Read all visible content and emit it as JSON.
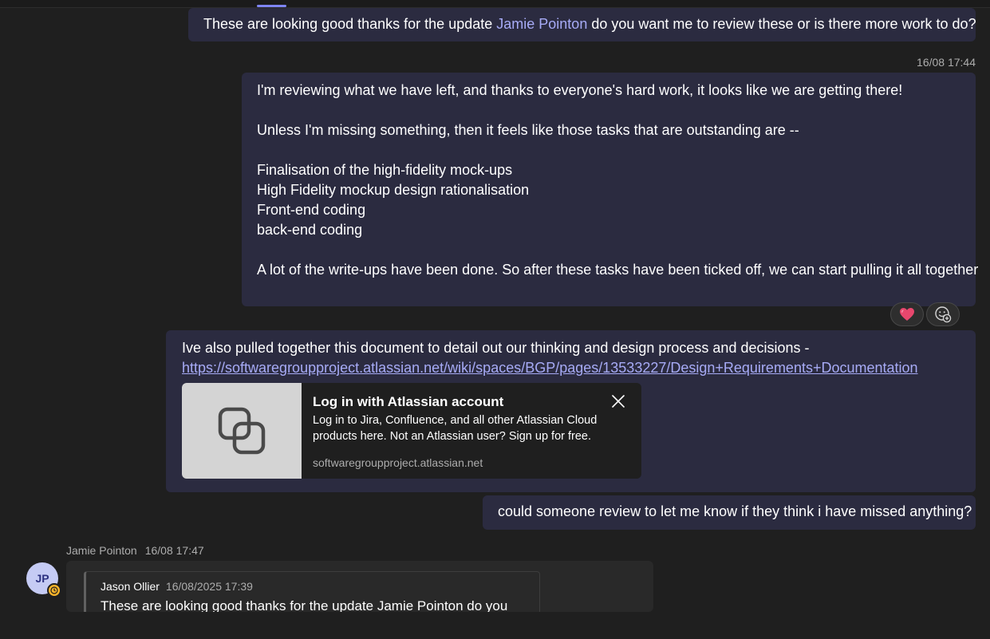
{
  "messages": {
    "m1": {
      "prefix": "These are looking good thanks for the update ",
      "mention": "Jamie Pointon",
      "suffix": " do you want me to review these or is there more work to do?"
    },
    "m2": {
      "timestamp": "16/08 17:44",
      "lines": [
        "I'm reviewing what we have left, and thanks to everyone's hard work, it looks like we are getting there!",
        "",
        "Unless I'm missing something, then it feels like those tasks that are outstanding are --",
        "",
        "Finalisation of the high-fidelity mock-ups",
        "High Fidelity mockup design rationalisation",
        "Front-end coding",
        "back-end coding",
        "",
        "A lot of the write-ups have been done. So after these tasks have been ticked off, we can start pulling it all together"
      ],
      "reactions": [
        "heart-emoji",
        "add-reaction-icon"
      ]
    },
    "m3": {
      "text": "Ive also pulled together this document to detail out our thinking and design process and decisions -",
      "link": "https://softwaregroupproject.atlassian.net/wiki/spaces/BGP/pages/13533227/Design+Requirements+Documentation",
      "preview": {
        "title": "Log in with Atlassian account",
        "description": "Log in to Jira, Confluence, and all other Atlassian Cloud products here. Not an Atlassian user? Sign up for free.",
        "domain": "softwaregroupproject.atlassian.net"
      }
    },
    "m4": {
      "text": "could someone review to let me know if they think i have missed anything?"
    },
    "m5": {
      "author": "Jamie Pointon",
      "timestamp": "16/08 17:47",
      "avatar_initials": "JP",
      "presence": "away",
      "quote": {
        "author": "Jason Ollier",
        "timestamp": "16/08/2025 17:39",
        "text": "These are looking good thanks for the update Jamie Pointon do you"
      }
    }
  },
  "colors": {
    "background": "#1f1f1f",
    "own_bubble": "#2b2b40",
    "accent": "#a7abf6",
    "presence_away": "#fcb52a"
  }
}
